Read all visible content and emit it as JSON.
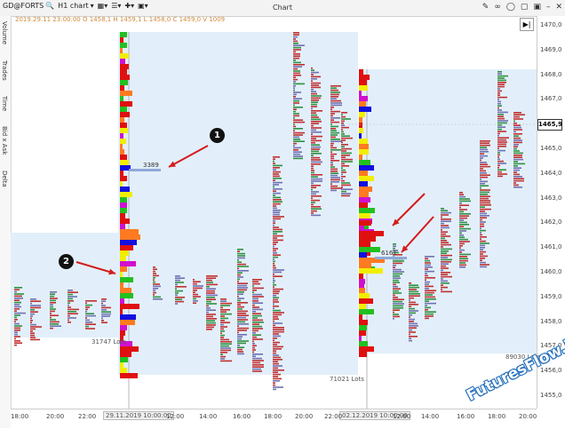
{
  "toolbar": {
    "symbol": "GD@FORTS",
    "timeframe": "H1 chart",
    "window_title": "Chart"
  },
  "ohlc_line": "2019.29.11 23:00:00 O 1458,1 H 1459,1 L 1458,0 C 1459,0 V 1009",
  "sidebar_tabs": [
    "Volume",
    "Trades",
    "Time",
    "Bid x Ask",
    "Delta"
  ],
  "y_axis": {
    "ticks": [
      "1470,0",
      "1469,0",
      "1468,0",
      "1467,0",
      "1466,0",
      "1465,0",
      "1464,0",
      "1463,0",
      "1462,0",
      "1461,0",
      "1460,0",
      "1459,0",
      "1458,0",
      "1457,0",
      "1456,0",
      "1455,0"
    ],
    "current_price": "1465,9"
  },
  "x_axis": {
    "ticks": [
      "18:00",
      "20:00",
      "22:00",
      "12:00",
      "14:00",
      "16:00",
      "18:00",
      "20:00",
      "22:00",
      "12:00",
      "14:00",
      "16:00",
      "18:00",
      "20:00"
    ],
    "highlight_1": "29.11.2019 10:00:00",
    "highlight_2": "02.12.2019 10:00:00"
  },
  "lots": {
    "left": "31747 Lots",
    "middle": "71021 Lots",
    "right": "89030 Lots"
  },
  "profile_labels": {
    "first": "3389",
    "second": "6161"
  },
  "callouts": [
    "1",
    "2"
  ],
  "watermark": "FuturesFlow.io",
  "colors": {
    "profile_bg": "#e2effa",
    "cluster_red": "#e01010",
    "cluster_yellow": "#f2ee00",
    "cluster_green": "#22c020",
    "cluster_blue": "#1010e0",
    "cluster_magenta": "#d010d0",
    "poc_line": "#8fa8d8",
    "arrow": "#d41c1c"
  }
}
